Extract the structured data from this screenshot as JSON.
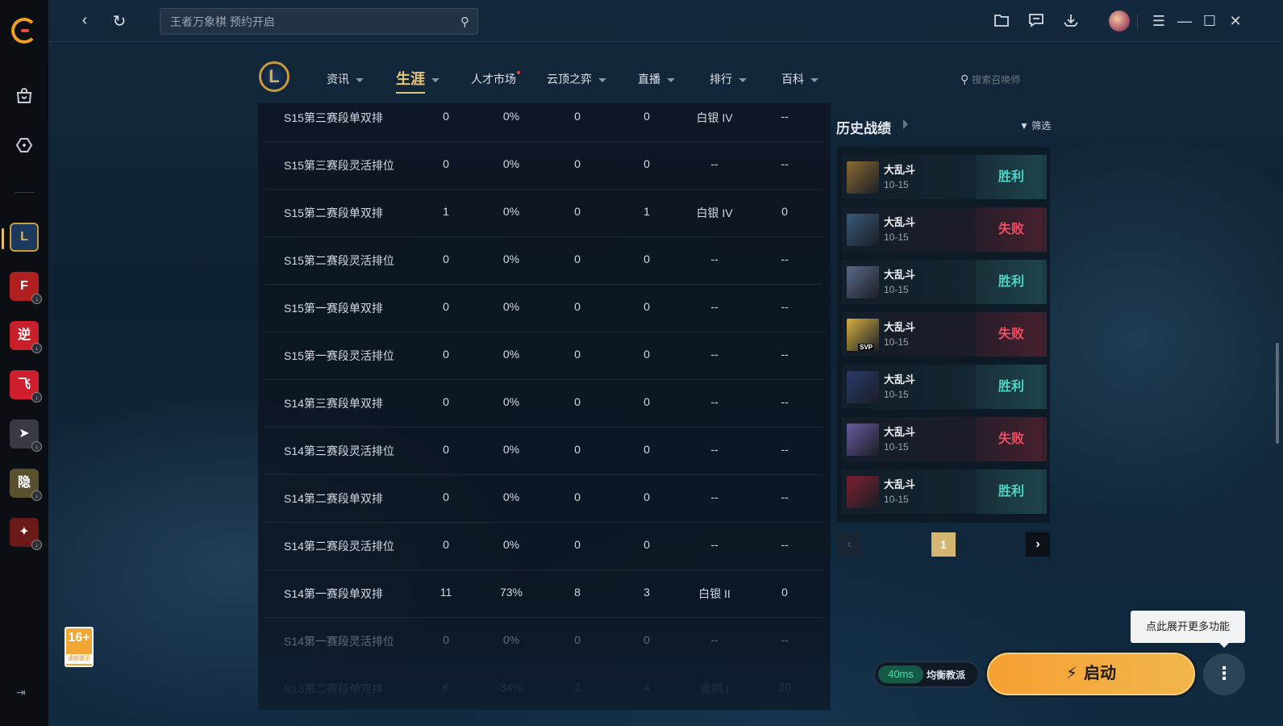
{
  "topbar": {
    "search_placeholder": "王者万象棋 预约开启"
  },
  "lol_nav": {
    "tabs": [
      {
        "label": "资讯",
        "caret": true
      },
      {
        "label": "生涯",
        "caret": true,
        "active": true
      },
      {
        "label": "人才市场",
        "dot": true
      },
      {
        "label": "云顶之弈",
        "caret": true
      },
      {
        "label": "直播",
        "caret": true
      },
      {
        "label": "排行",
        "caret": true
      },
      {
        "label": "百科",
        "caret": true
      }
    ],
    "summoner_search_placeholder": "搜索召唤师"
  },
  "sidebar": {
    "games": [
      {
        "name": "league-of-legends",
        "glyph": "L",
        "color": "#1b3a5c"
      },
      {
        "name": "crossfire",
        "glyph": "F",
        "color": "#b02020"
      },
      {
        "name": "ni-shui-han",
        "glyph": "逆",
        "color": "#c8202a"
      },
      {
        "name": "qq-speed",
        "glyph": "飞",
        "color": "#d02030"
      },
      {
        "name": "nz",
        "glyph": "➤",
        "color": "#3a3a44"
      },
      {
        "name": "yin",
        "glyph": "隐",
        "color": "#5a5030"
      },
      {
        "name": "dnf",
        "glyph": "✦",
        "color": "#6a1818"
      }
    ],
    "age_badge": {
      "rating": "16+",
      "label": "适龄提示"
    }
  },
  "season_table": {
    "rows": [
      [
        "S15第三赛段单双排",
        "0",
        "0%",
        "0",
        "0",
        "白银 IV",
        "--"
      ],
      [
        "S15第三赛段灵活排位",
        "0",
        "0%",
        "0",
        "0",
        "--",
        "--"
      ],
      [
        "S15第二赛段单双排",
        "1",
        "0%",
        "0",
        "1",
        "白银 IV",
        "0"
      ],
      [
        "S15第二赛段灵活排位",
        "0",
        "0%",
        "0",
        "0",
        "--",
        "--"
      ],
      [
        "S15第一赛段单双排",
        "0",
        "0%",
        "0",
        "0",
        "--",
        "--"
      ],
      [
        "S15第一赛段灵活排位",
        "0",
        "0%",
        "0",
        "0",
        "--",
        "--"
      ],
      [
        "S14第三赛段单双排",
        "0",
        "0%",
        "0",
        "0",
        "--",
        "--"
      ],
      [
        "S14第三赛段灵活排位",
        "0",
        "0%",
        "0",
        "0",
        "--",
        "--"
      ],
      [
        "S14第二赛段单双排",
        "0",
        "0%",
        "0",
        "0",
        "--",
        "--"
      ],
      [
        "S14第二赛段灵活排位",
        "0",
        "0%",
        "0",
        "0",
        "--",
        "--"
      ],
      [
        "S14第一赛段单双排",
        "11",
        "73%",
        "8",
        "3",
        "白银 II",
        "0"
      ],
      [
        "S14第一赛段灵活排位",
        "0",
        "0%",
        "0",
        "0",
        "--",
        "--"
      ],
      [
        "S13第二赛段单双排",
        "6",
        "34%",
        "2",
        "4",
        "青铜 I",
        "20"
      ]
    ]
  },
  "history": {
    "title": "历史战绩",
    "filter_label": "筛选",
    "matches": [
      {
        "mode": "大乱斗",
        "date": "10-15",
        "result": "胜利",
        "win": true,
        "champ_color": "#8a6a30"
      },
      {
        "mode": "大乱斗",
        "date": "10-15",
        "result": "失败",
        "win": false,
        "champ_color": "#3a5a78"
      },
      {
        "mode": "大乱斗",
        "date": "10-15",
        "result": "胜利",
        "win": true,
        "champ_color": "#5a6a88"
      },
      {
        "mode": "大乱斗",
        "date": "10-15",
        "result": "失败",
        "win": false,
        "champ_color": "#d8b040"
      },
      {
        "mode": "大乱斗",
        "date": "10-15",
        "result": "胜利",
        "win": true,
        "champ_color": "#2a3a6a"
      },
      {
        "mode": "大乱斗",
        "date": "10-15",
        "result": "失败",
        "win": false,
        "champ_color": "#6a5aa0"
      },
      {
        "mode": "大乱斗",
        "date": "10-15",
        "result": "胜利",
        "win": true,
        "champ_color": "#7a2030"
      }
    ],
    "svp_badge": "SVP",
    "page": "1"
  },
  "bottom": {
    "tooltip": "点此展开更多功能",
    "ping": "40ms",
    "server": "均衡教派",
    "launch_label": "启动"
  }
}
